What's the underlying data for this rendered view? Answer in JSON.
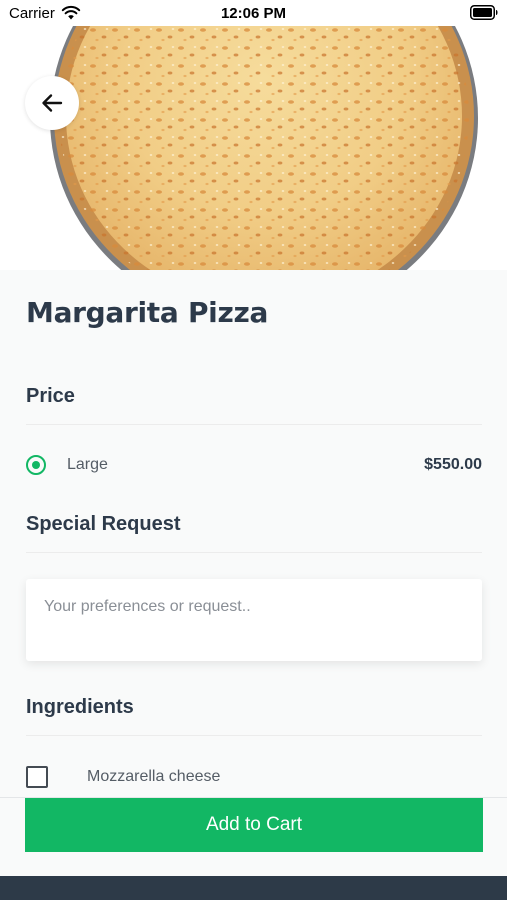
{
  "status_bar": {
    "carrier": "Carrier",
    "time": "12:06 PM",
    "wifi_icon": "wifi-icon",
    "battery_icon": "battery-full-icon"
  },
  "hero": {
    "image": "cheese-pizza-photo",
    "back_icon": "arrow-left-icon"
  },
  "product": {
    "title": "Margarita Pizza"
  },
  "price_section": {
    "heading": "Price",
    "options": [
      {
        "size": "Large",
        "price": "$550.00",
        "selected": true
      }
    ]
  },
  "special_request": {
    "heading": "Special Request",
    "placeholder": "Your preferences or request..",
    "value": ""
  },
  "ingredients": {
    "heading": "Ingredients",
    "items": [
      {
        "label": "Mozzarella cheese",
        "checked": false
      }
    ]
  },
  "cart": {
    "button_label": "Add to Cart"
  },
  "colors": {
    "accent": "#12b764",
    "heading": "#2d3a4a",
    "footer": "#2d3a48",
    "background": "#f9fafa"
  }
}
